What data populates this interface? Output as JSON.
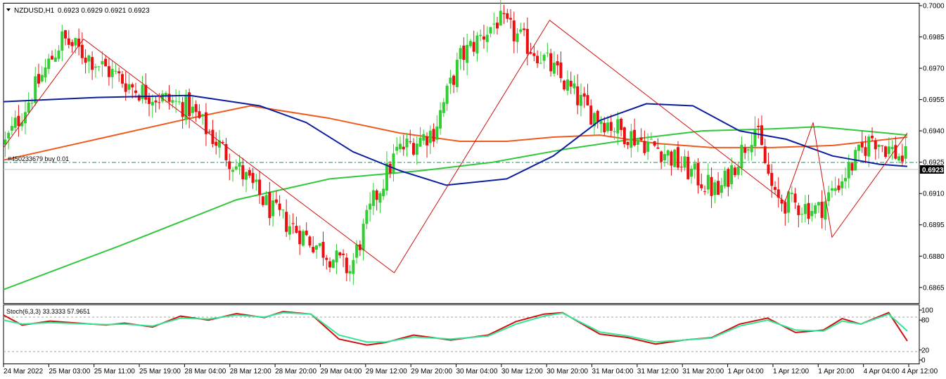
{
  "chart_header": {
    "symbol_tf": "NZDUSD,H1",
    "ohlc": "0.6923 0.6929 0.6921 0.6923"
  },
  "order_line": {
    "label": "#450233679 buy 0.01",
    "price": 0.6932
  },
  "current_price": {
    "label": "0.6923",
    "value": 0.6923
  },
  "stoch_panel": {
    "label": "Stoch(6,3,3) 33.3333 57.9651",
    "ticks": [
      "100",
      "80",
      "20",
      "0"
    ]
  },
  "colors": {
    "bull": "#32CD32",
    "bear": "#E81010",
    "ma_blue": "#0A1E9E",
    "ma_orange": "#F05A1E",
    "ma_green": "#32C83C",
    "zigzag": "#D01010",
    "stoch_main": "#D01010",
    "stoch_signal": "#32E696",
    "order_line": "#1E8C5A"
  },
  "chart_data": [
    {
      "type": "candlestick",
      "title": "NZDUSD,H1",
      "ylim": [
        0.6862,
        0.7
      ],
      "y_ticks": [
        "0.7000",
        "0.6985",
        "0.6970",
        "0.6955",
        "0.6940",
        "0.6925",
        "0.6910",
        "0.6895",
        "0.6880",
        "0.6865"
      ],
      "x_ticks": [
        "24 Mar 2022",
        "25 Mar 03:00",
        "25 Mar 11:00",
        "25 Mar 19:00",
        "28 Mar 04:00",
        "28 Mar 12:00",
        "28 Mar 20:00",
        "29 Mar 04:00",
        "29 Mar 12:00",
        "29 Mar 20:00",
        "30 Mar 04:00",
        "30 Mar 12:00",
        "30 Mar 20:00",
        "31 Mar 04:00",
        "31 Mar 12:00",
        "31 Mar 20:00",
        "1 Apr 04:00",
        "1 Apr 12:00",
        "1 Apr 20:00",
        "4 Apr 04:00",
        "4 Apr 12:00"
      ],
      "anchors": [
        [
          0,
          0.6934
        ],
        [
          17,
          0.6984
        ],
        [
          39,
          0.696
        ],
        [
          55,
          0.6951
        ],
        [
          80,
          0.6901
        ],
        [
          90,
          0.6889
        ],
        [
          103,
          0.6873
        ],
        [
          110,
          0.6906
        ],
        [
          117,
          0.693
        ],
        [
          128,
          0.694
        ],
        [
          136,
          0.6975
        ],
        [
          147,
          0.6993
        ],
        [
          160,
          0.6976
        ],
        [
          174,
          0.695
        ],
        [
          184,
          0.694
        ],
        [
          196,
          0.6931
        ],
        [
          213,
          0.691
        ],
        [
          224,
          0.6942
        ],
        [
          230,
          0.6907
        ],
        [
          243,
          0.6902
        ],
        [
          259,
          0.6937
        ],
        [
          268,
          0.6927
        ]
      ],
      "zigzag": [
        [
          0,
          0.6932
        ],
        [
          17,
          0.6984
        ],
        [
          83,
          0.6872
        ],
        [
          116,
          0.6993
        ],
        [
          166,
          0.6906
        ],
        [
          172,
          0.6944
        ],
        [
          176,
          0.6889
        ],
        [
          192,
          0.6939
        ]
      ],
      "ma_blue": [
        [
          0,
          0.6954
        ],
        [
          20,
          0.6956
        ],
        [
          40,
          0.6957
        ],
        [
          55,
          0.6952
        ],
        [
          65,
          0.6944
        ],
        [
          75,
          0.693
        ],
        [
          85,
          0.6921
        ],
        [
          95,
          0.6914
        ],
        [
          108,
          0.6917
        ],
        [
          118,
          0.6928
        ],
        [
          128,
          0.6945
        ],
        [
          138,
          0.6953
        ],
        [
          148,
          0.6952
        ],
        [
          158,
          0.694
        ],
        [
          168,
          0.6936
        ],
        [
          178,
          0.6928
        ],
        [
          188,
          0.6924
        ],
        [
          194,
          0.6923
        ]
      ],
      "ma_orange": [
        [
          0,
          0.6926
        ],
        [
          20,
          0.6936
        ],
        [
          40,
          0.6946
        ],
        [
          53,
          0.6952
        ],
        [
          70,
          0.6946
        ],
        [
          85,
          0.6939
        ],
        [
          98,
          0.6935
        ],
        [
          108,
          0.6935
        ],
        [
          118,
          0.6937
        ],
        [
          128,
          0.6938
        ],
        [
          140,
          0.6934
        ],
        [
          152,
          0.6932
        ],
        [
          165,
          0.6932
        ],
        [
          178,
          0.6933
        ],
        [
          194,
          0.6937
        ]
      ],
      "ma_green": [
        [
          0,
          0.6864
        ],
        [
          25,
          0.6885
        ],
        [
          50,
          0.6907
        ],
        [
          70,
          0.6917
        ],
        [
          90,
          0.6921
        ],
        [
          105,
          0.6925
        ],
        [
          120,
          0.6931
        ],
        [
          135,
          0.6936
        ],
        [
          150,
          0.694
        ],
        [
          165,
          0.6941
        ],
        [
          175,
          0.6942
        ],
        [
          194,
          0.6938
        ]
      ]
    },
    {
      "type": "line",
      "title": "Stoch(6,3,3) 33.3333 57.9651",
      "ylim": [
        0,
        100
      ],
      "y_ticks": [
        "100",
        "80",
        "20",
        "0"
      ],
      "series": [
        {
          "name": "main",
          "x": [
            0,
            4,
            10,
            16,
            22,
            26,
            32,
            38,
            44,
            50,
            56,
            60,
            66,
            72,
            78,
            82,
            88,
            96,
            104,
            110,
            116,
            120,
            128,
            134,
            140,
            146,
            152,
            158,
            164,
            170,
            176,
            180,
            184,
            190,
            194
          ],
          "values": [
            90,
            70,
            78,
            74,
            70,
            74,
            66,
            88,
            80,
            93,
            85,
            97,
            92,
            42,
            30,
            35,
            50,
            40,
            50,
            77,
            92,
            95,
            52,
            45,
            32,
            40,
            45,
            72,
            84,
            55,
            60,
            83,
            72,
            95,
            38
          ]
        },
        {
          "name": "signal",
          "x": [
            0,
            4,
            10,
            16,
            22,
            26,
            32,
            38,
            44,
            50,
            56,
            60,
            66,
            72,
            78,
            82,
            88,
            96,
            104,
            110,
            116,
            120,
            128,
            134,
            140,
            146,
            152,
            158,
            164,
            170,
            176,
            180,
            184,
            190,
            194
          ],
          "values": [
            80,
            72,
            75,
            73,
            71,
            72,
            68,
            84,
            82,
            90,
            86,
            95,
            92,
            50,
            36,
            36,
            46,
            42,
            48,
            72,
            88,
            94,
            56,
            48,
            36,
            40,
            44,
            68,
            80,
            60,
            58,
            78,
            72,
            92,
            58
          ]
        }
      ]
    }
  ]
}
